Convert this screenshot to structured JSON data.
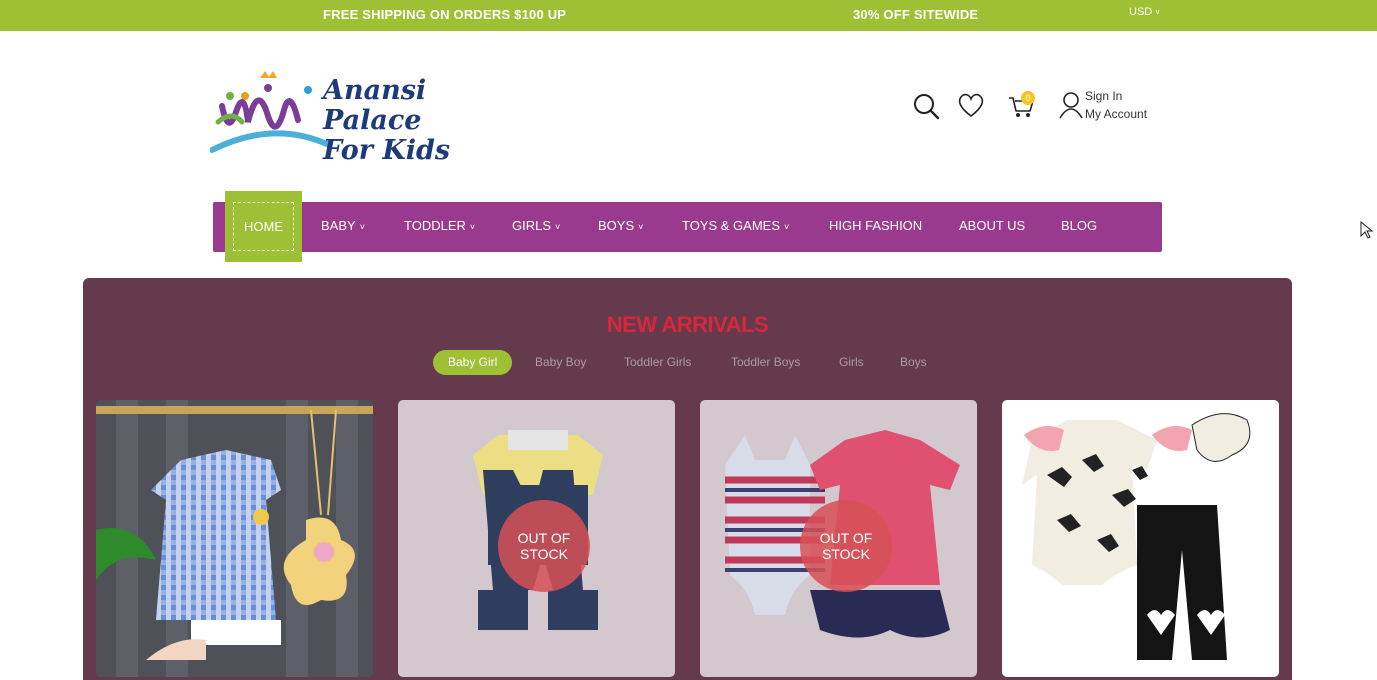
{
  "topbar": {
    "message_left": "FREE SHIPPING ON ORDERS $100 UP",
    "message_right": "30% OFF SITEWIDE",
    "currency": "USD"
  },
  "logo": {
    "line1": "Anansi Palace",
    "line2": "For Kids"
  },
  "header": {
    "cart_count": "0",
    "sign_in": "Sign In",
    "my_account": "My Account"
  },
  "nav": {
    "home": "HOME",
    "items": [
      "BABY",
      "TODDLER",
      "GIRLS",
      "BOYS",
      "TOYS & GAMES",
      "HIGH FASHION",
      "ABOUT US",
      "BLOG"
    ]
  },
  "section": {
    "title": "NEW ARRIVALS",
    "filters": [
      "Baby Girl",
      "Baby Boy",
      "Toddler Girls",
      "Toddler Boys",
      "Girls",
      "Boys"
    ],
    "active_filter": "Baby Girl"
  },
  "products": [
    {
      "status": ""
    },
    {
      "status": "OUT OF STOCK"
    },
    {
      "status": "OUT OF STOCK"
    },
    {
      "status": ""
    }
  ],
  "colors": {
    "accent_green": "#9ec034",
    "nav_purple": "#9a3a8e",
    "panel": "#643a4c",
    "title_red": "#d8263c"
  }
}
